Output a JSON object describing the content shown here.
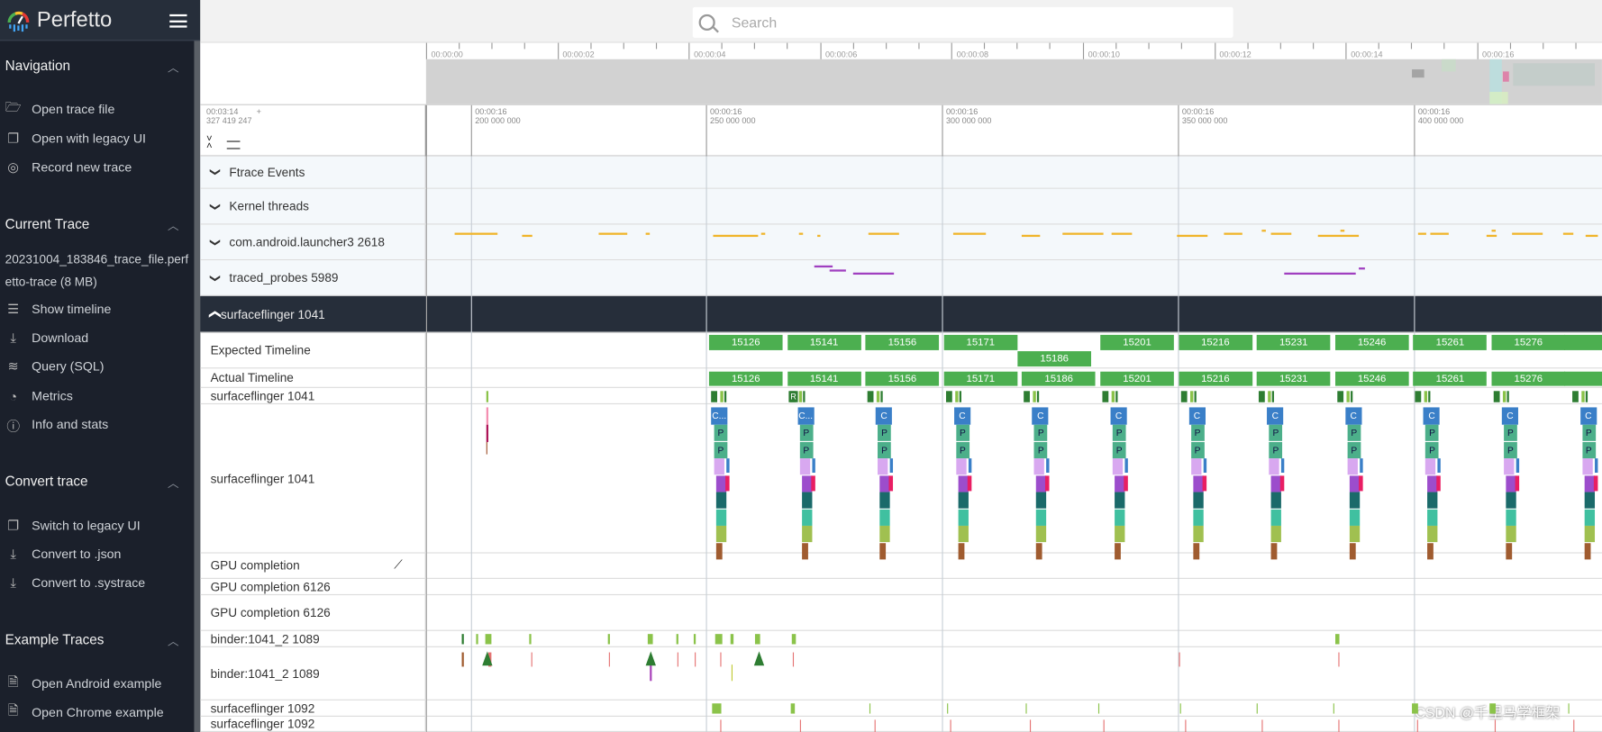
{
  "app": {
    "name": "Perfetto"
  },
  "search": {
    "placeholder": "Search",
    "value": ""
  },
  "sidebar": {
    "sections": [
      {
        "title": "Navigation",
        "items": [
          {
            "label": "Open trace file",
            "icon": "folder-open-icon"
          },
          {
            "label": "Open with legacy UI",
            "icon": "filter-none-icon"
          },
          {
            "label": "Record new trace",
            "icon": "fiber-smart-record-icon"
          }
        ]
      },
      {
        "title": "Current Trace",
        "trace_name": "20231004_183846_trace_file.perfetto-trace (8 MB)",
        "items": [
          {
            "label": "Show timeline",
            "icon": "timeline-icon"
          },
          {
            "label": "Download",
            "icon": "download-icon"
          },
          {
            "label": "Query (SQL)",
            "icon": "database-icon"
          },
          {
            "label": "Metrics",
            "icon": "speed-icon"
          },
          {
            "label": "Info and stats",
            "icon": "info-icon"
          }
        ]
      },
      {
        "title": "Convert trace",
        "items": [
          {
            "label": "Switch to legacy UI",
            "icon": "filter-none-icon"
          },
          {
            "label": "Convert to .json",
            "icon": "download-icon"
          },
          {
            "label": "Convert to .systrace",
            "icon": "download-icon"
          }
        ]
      },
      {
        "title": "Example Traces",
        "items": [
          {
            "label": "Open Android example",
            "icon": "description-icon"
          },
          {
            "label": "Open Chrome example",
            "icon": "description-icon"
          }
        ]
      }
    ]
  },
  "overview": {
    "ticks": [
      "00:00:00",
      "00:00:02",
      "00:00:04",
      "00:00:06",
      "00:00:08",
      "00:00:10",
      "00:00:12",
      "00:00:14",
      "00:00:16"
    ]
  },
  "axis": {
    "offset_time": "00:03:14",
    "offset_plus": "+",
    "offset_ns": "327 419 247",
    "ticks": [
      {
        "t": "00:00:16",
        "ns": "200 000 000"
      },
      {
        "t": "00:00:16",
        "ns": "250 000 000"
      },
      {
        "t": "00:00:16",
        "ns": "300 000 000"
      },
      {
        "t": "00:00:16",
        "ns": "350 000 000"
      },
      {
        "t": "00:00:16",
        "ns": "400 000 000"
      }
    ]
  },
  "tracks": {
    "groups": [
      "Ftrace Events",
      "Kernel threads",
      "com.android.launcher3 2618",
      "traced_probes 5989"
    ],
    "expanded_group": "surfaceflinger 1041",
    "rows": [
      "Expected Timeline",
      "Actual Timeline",
      "surfaceflinger 1041",
      "surfaceflinger 1041",
      "GPU completion",
      "GPU completion 6126",
      "GPU completion 6126",
      "binder:1041_2 1089",
      "binder:1041_2 1089",
      "surfaceflinger 1092",
      "surfaceflinger 1092"
    ]
  },
  "expected_frames": [
    "15126",
    "15141",
    "15156",
    "15171",
    "15186",
    "15201",
    "15216",
    "15231",
    "15246",
    "15261",
    "15276"
  ],
  "actual_frames": [
    "15126",
    "15141",
    "15156",
    "15171",
    "15186",
    "15201",
    "15216",
    "15231",
    "15246",
    "15261",
    "15276"
  ],
  "slice_labels": {
    "composite": "C...",
    "present": "P",
    "refresh": "R"
  },
  "colors": {
    "frame": "#4caf50",
    "sidebar": "#1b202b",
    "header": "#262e3a",
    "launcher": "#f0b429",
    "traced": "#a040c0"
  },
  "watermark": "CSDN @千里马学框架"
}
